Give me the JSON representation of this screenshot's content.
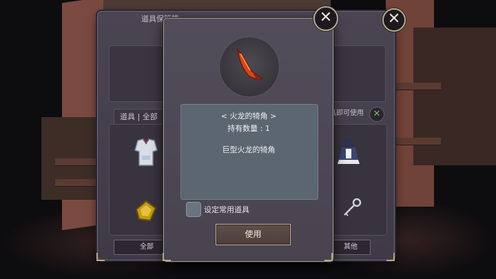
{
  "back_window": {
    "title": "道具保管箱",
    "tab_label": "道具 | 全部",
    "note": "具即可使用",
    "all_button": "全部",
    "other_button": "其他"
  },
  "detail": {
    "item_name": "< 火龙的犄角 >",
    "quantity_text": "持有数量 :  1",
    "description": "巨型火龙的犄角",
    "favorite_label": "设定常用道具",
    "use_button": "使用"
  },
  "icons": {
    "close": "close-x-icon",
    "item": "fire-dragon-horn-icon"
  },
  "colors": {
    "accent_gold": "#b6a883",
    "panel": "#5b6670"
  }
}
